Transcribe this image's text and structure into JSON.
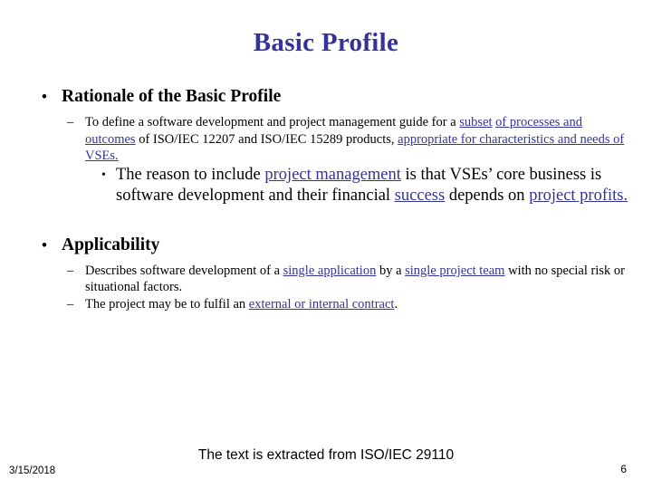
{
  "slide": {
    "title": "Basic Profile",
    "title_color": "#333399",
    "link_color": "#333399",
    "background": "#ffffff",
    "bullets": {
      "level1_marker": "•",
      "level2_marker": "–",
      "level3_marker": "•"
    },
    "sections": [
      {
        "heading": "Rationale of the Basic Profile",
        "level2": [
          {
            "runs": [
              {
                "text": "To define a software development and project management guide for a ",
                "link": false
              },
              {
                "text": "subset",
                "link": true
              },
              {
                "text": " ",
                "link": false
              },
              {
                "text": "of processes and outcomes",
                "link": true
              },
              {
                "text": " of ISO/IEC 12207 and ISO/IEC 15289 products, ",
                "link": false
              },
              {
                "text": "appropriate for characteristics and needs of VSEs.",
                "link": true
              }
            ]
          }
        ],
        "level3": [
          {
            "runs": [
              {
                "text": "The reason to include ",
                "link": false
              },
              {
                "text": "project management",
                "link": true
              },
              {
                "text": " is that VSEs’ core business is software development and their financial ",
                "link": false
              },
              {
                "text": "success",
                "link": true
              },
              {
                "text": " depends on ",
                "link": false
              },
              {
                "text": "project profits.",
                "link": true
              }
            ]
          }
        ]
      },
      {
        "heading": "Applicability",
        "level2": [
          {
            "runs": [
              {
                "text": "Describes software development of a ",
                "link": false
              },
              {
                "text": "single application",
                "link": true
              },
              {
                "text": " by a ",
                "link": false
              },
              {
                "text": "single project team",
                "link": true
              },
              {
                "text": " with no special risk or situational factors.",
                "link": false
              }
            ]
          },
          {
            "runs": [
              {
                "text": "The project may be to fulfil an ",
                "link": false
              },
              {
                "text": "external or internal contract",
                "link": true
              },
              {
                "text": ".",
                "link": false
              }
            ]
          }
        ],
        "level3": []
      }
    ],
    "footer_note": "The text is extracted from ISO/IEC 29110",
    "date": "3/15/2018",
    "page_number": "6"
  }
}
